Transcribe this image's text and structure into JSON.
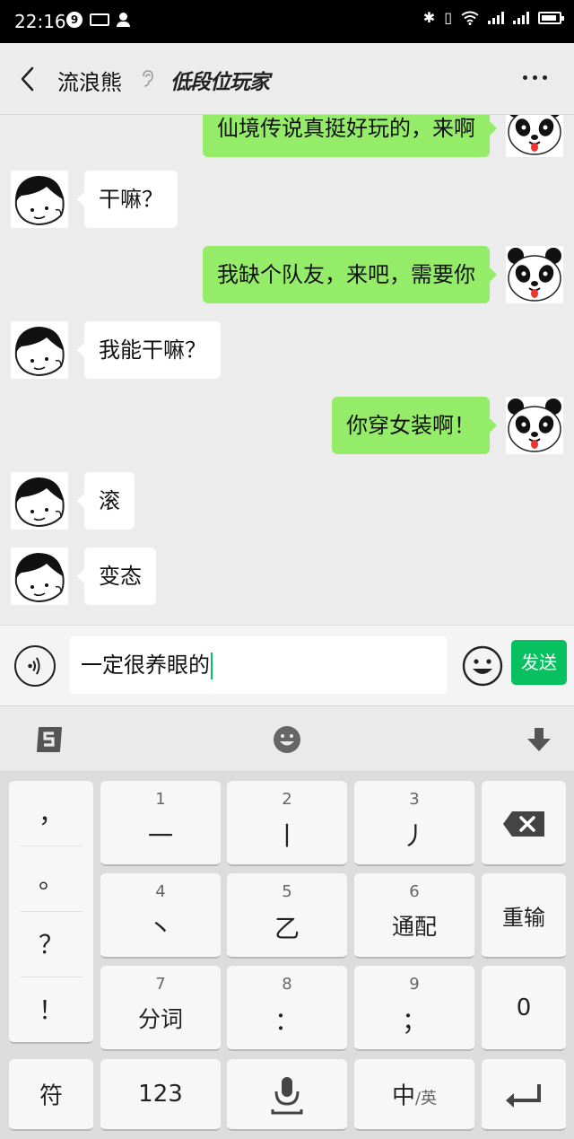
{
  "status_bar": {
    "time": "22:16",
    "notification_count": "9"
  },
  "header": {
    "contact_name": "流浪熊",
    "logo_text": "低段位玩家"
  },
  "messages": [
    {
      "side": "out",
      "text": "仙境传说真挺好玩的，来啊"
    },
    {
      "side": "in",
      "text": "干嘛？"
    },
    {
      "side": "out",
      "text": "我缺个队友，来吧，需要你"
    },
    {
      "side": "in",
      "text": "我能干嘛？"
    },
    {
      "side": "out",
      "text": "你穿女装啊！"
    },
    {
      "side": "in",
      "text": "滚"
    },
    {
      "side": "in",
      "text": "变态"
    }
  ],
  "input": {
    "value": "一定很养眼的",
    "send_label": "发送"
  },
  "keyboard": {
    "punctuation": [
      "，",
      "。",
      "？",
      "！"
    ],
    "keys": [
      {
        "num": "1",
        "label": "一"
      },
      {
        "num": "2",
        "label": "丨"
      },
      {
        "num": "3",
        "label": "丿"
      },
      {
        "num": "4",
        "label": "丶"
      },
      {
        "num": "5",
        "label": "乙"
      },
      {
        "num": "6",
        "label": "通配"
      },
      {
        "num": "7",
        "label": "分词"
      },
      {
        "num": "8",
        "label": "："
      },
      {
        "num": "9",
        "label": "；"
      }
    ],
    "retype_label": "重输",
    "zero_label": "0",
    "symbol_label": "符",
    "numbers_label": "123",
    "lang_main": "中",
    "lang_alt": "/英"
  },
  "colors": {
    "send_green": "#07c160",
    "outgoing_bubble": "#95ec69"
  }
}
